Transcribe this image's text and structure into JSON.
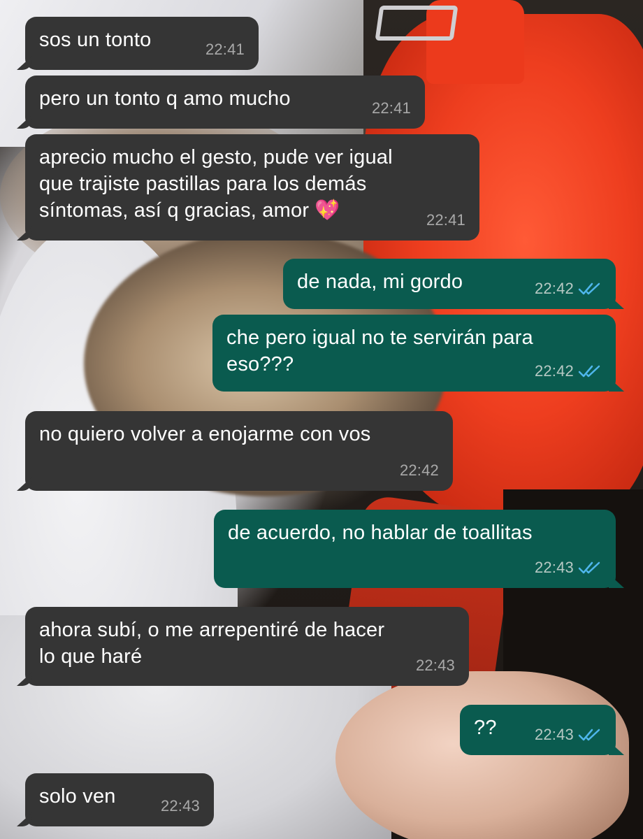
{
  "colors": {
    "incoming_bubble": "#353535",
    "outgoing_bubble": "#0a5b4f",
    "read_ticks": "#4fb6ec",
    "timestamp": "#a9a9a9"
  },
  "messages": [
    {
      "direction": "in",
      "text": "sos un tonto",
      "time": "22:41"
    },
    {
      "direction": "in",
      "text": "pero un tonto q amo mucho",
      "time": "22:41"
    },
    {
      "direction": "in",
      "text": "aprecio mucho el gesto, pude ver igual\nque trajiste pastillas para los demás\nsíntomas, así q gracias, amor 💖",
      "time": "22:41"
    },
    {
      "direction": "out",
      "text": "de nada, mi gordo",
      "time": "22:42",
      "status_icon": "double-check-read-icon"
    },
    {
      "direction": "out",
      "text": "che pero igual no te servirán para\neso???",
      "time": "22:42",
      "status_icon": "double-check-read-icon"
    },
    {
      "direction": "in",
      "text": "no quiero volver a enojarme con vos",
      "time": "22:42"
    },
    {
      "direction": "out",
      "text": "de acuerdo, no hablar de toallitas",
      "time": "22:43",
      "status_icon": "double-check-read-icon"
    },
    {
      "direction": "in",
      "text": "ahora subí, o me arrepentiré de hacer\nlo que haré",
      "time": "22:43"
    },
    {
      "direction": "out",
      "text": "??",
      "time": "22:43",
      "status_icon": "double-check-read-icon"
    },
    {
      "direction": "in",
      "text": "solo ven",
      "time": "22:43"
    }
  ]
}
